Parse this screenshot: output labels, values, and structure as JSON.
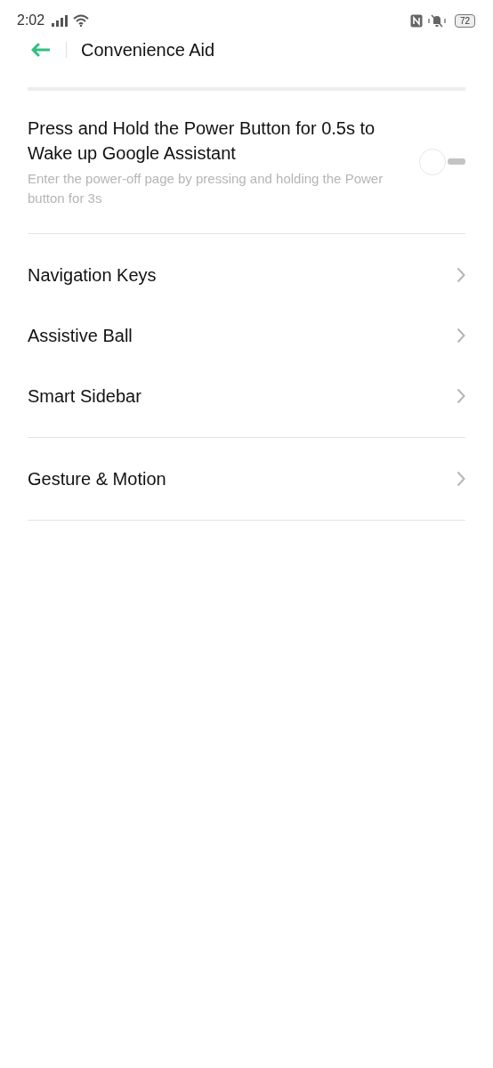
{
  "status_bar": {
    "time": "2:02",
    "battery": "72"
  },
  "header": {
    "title": "Convenience Aid"
  },
  "sections": [
    {
      "items": [
        {
          "kind": "toggle",
          "title": "Press and Hold the Power Button for 0.5s to Wake up Google Assistant",
          "subtitle": "Enter the power-off page by pressing and holding the Power button for 3s",
          "on": false
        }
      ]
    },
    {
      "items": [
        {
          "kind": "link",
          "title": "Navigation Keys"
        },
        {
          "kind": "link",
          "title": "Assistive Ball"
        },
        {
          "kind": "link",
          "title": "Smart Sidebar"
        }
      ]
    },
    {
      "items": [
        {
          "kind": "link",
          "title": "Gesture & Motion"
        }
      ]
    }
  ]
}
